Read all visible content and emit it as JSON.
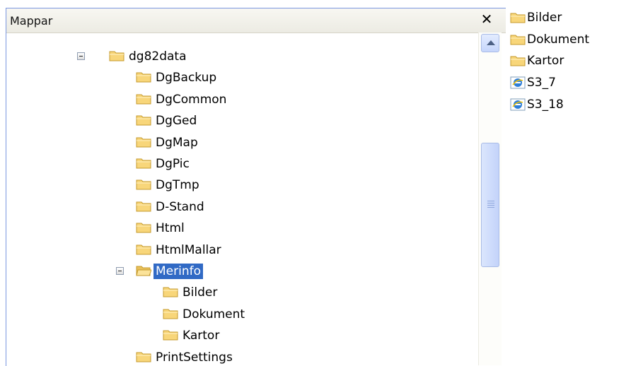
{
  "left_pane": {
    "title": "Mappar",
    "close_glyph": "✕",
    "tree": [
      {
        "label": "dg82data",
        "indent": 0,
        "expander": "collapse",
        "icon": "folder-icon"
      },
      {
        "label": "DgBackup",
        "indent": 1,
        "icon": "folder-icon"
      },
      {
        "label": "DgCommon",
        "indent": 1,
        "icon": "folder-icon"
      },
      {
        "label": "DgGed",
        "indent": 1,
        "icon": "folder-icon"
      },
      {
        "label": "DgMap",
        "indent": 1,
        "icon": "folder-icon"
      },
      {
        "label": "DgPic",
        "indent": 1,
        "icon": "folder-icon"
      },
      {
        "label": "DgTmp",
        "indent": 1,
        "icon": "folder-icon"
      },
      {
        "label": "D-Stand",
        "indent": 1,
        "icon": "folder-icon"
      },
      {
        "label": "Html",
        "indent": 1,
        "icon": "folder-icon"
      },
      {
        "label": "HtmlMallar",
        "indent": 1,
        "icon": "folder-icon"
      },
      {
        "label": "Merinfo",
        "indent": 1,
        "expander": "collapse",
        "icon": "folder-open-icon",
        "selected": true
      },
      {
        "label": "Bilder",
        "indent": 2,
        "icon": "folder-icon"
      },
      {
        "label": "Dokument",
        "indent": 2,
        "icon": "folder-icon"
      },
      {
        "label": "Kartor",
        "indent": 2,
        "icon": "folder-icon"
      },
      {
        "label": "PrintSettings",
        "indent": 1,
        "icon": "folder-icon"
      }
    ]
  },
  "right_pane": {
    "items": [
      {
        "label": "Bilder",
        "icon": "folder-icon"
      },
      {
        "label": "Dokument",
        "icon": "folder-icon"
      },
      {
        "label": "Kartor",
        "icon": "folder-icon"
      },
      {
        "label": "S3_7",
        "icon": "internet-explorer-icon"
      },
      {
        "label": "S3_18",
        "icon": "internet-explorer-icon"
      }
    ]
  },
  "colors": {
    "selection": "#316ac5",
    "pane_border": "#7a96df",
    "folder_fill": "#f8d67a",
    "folder_stroke": "#c49a2c"
  }
}
